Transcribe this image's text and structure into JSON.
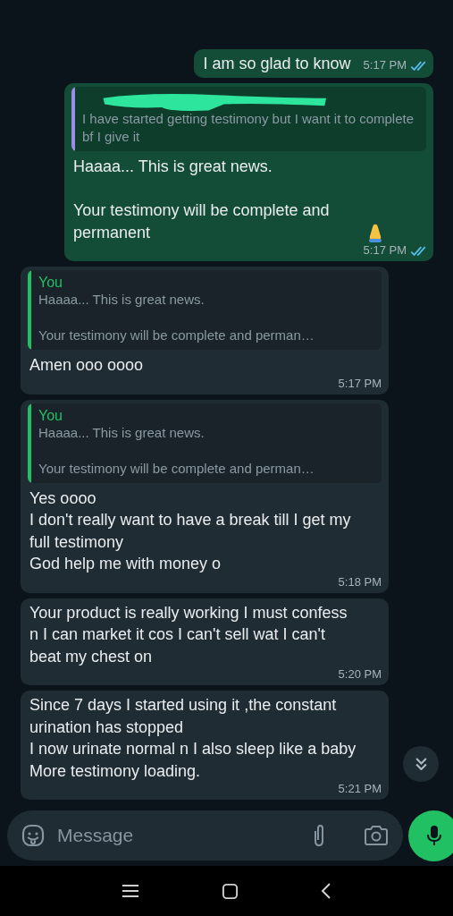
{
  "messages": [
    {
      "outgoing": true,
      "text": "I am so glad to know",
      "time": "5:17 PM",
      "read": true
    },
    {
      "outgoing": true,
      "quote": {
        "author_redacted": true,
        "color": "#9d8ce8",
        "text": "I have started getting testimony but I want it to complete bf I give it"
      },
      "text": "Haaaa... This is great news.\n\nYour testimony will be complete and permanent",
      "praying_hands": true,
      "time": "5:17 PM",
      "read": true
    },
    {
      "outgoing": false,
      "quote": {
        "author": "You",
        "color": "#21c063",
        "text": "Haaaa... This is great news.\n\nYour testimony will be complete and perman…"
      },
      "text": "Amen ooo oooo",
      "time": "5:17 PM"
    },
    {
      "outgoing": false,
      "quote": {
        "author": "You",
        "color": "#21c063",
        "text": "Haaaa... This is great news.\n\nYour testimony will be complete and perman…"
      },
      "text": "Yes oooo\nI don't really want to have a break till I get my full testimony\nGod help me with money o",
      "time": "5:18 PM"
    },
    {
      "outgoing": false,
      "text": "Your product is really working I must confess n I can market it cos I can't sell wat I can't beat my chest on",
      "time": "5:20 PM"
    },
    {
      "outgoing": false,
      "text": "Since 7 days I started using it ,the constant urination has stopped\nI now urinate normal n I also sleep like a baby\nMore testimony loading.",
      "time": "5:21 PM"
    }
  ],
  "composer": {
    "placeholder": "Message"
  }
}
